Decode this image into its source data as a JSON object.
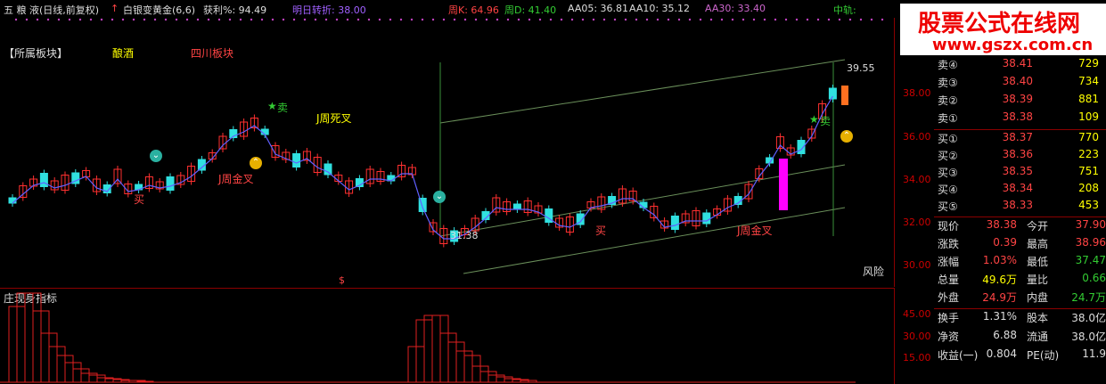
{
  "toolbar": {
    "stock_name": "五 粮 液(日线,前复权)",
    "arrow": "↑",
    "indicator_name": "白银变黄金(6,6)",
    "profit_label": "获利%: 94.49",
    "turn_label": "明日转折: 38.00",
    "weekk_label": "周K: 64.96",
    "weekd_label": "周D: 41.40",
    "aa05_label": "AA05: 36.81",
    "aa10_label": "AA10: 35.12",
    "aa30_label": "AA30: 33.40",
    "cut_label": "中轨:"
  },
  "sector": {
    "label": "【所属板块】",
    "tag1": "酿酒",
    "tag2": "四川板块"
  },
  "annotations": {
    "sell_top": "卖",
    "j_dead": "J周死叉",
    "j_gold1": "J周金叉",
    "j_gold2": "J周金叉",
    "buy1": "买",
    "buy2": "买",
    "sell2": "卖",
    "low_price": "31.38",
    "high_price": "39.55",
    "risk": "风险",
    "dollar": "$"
  },
  "price_axis": [
    "38.00",
    "36.00",
    "34.00",
    "32.00",
    "30.00"
  ],
  "indicator": {
    "title": "庄现身指标",
    "axis": [
      "45.00",
      "30.00",
      "15.00"
    ]
  },
  "watermark": {
    "title": "股票公式在线网",
    "url": "www.gszx.com.cn"
  },
  "quote": {
    "asks": [
      {
        "label": "卖④",
        "price": "38.41",
        "vol": "729"
      },
      {
        "label": "卖③",
        "price": "38.40",
        "vol": "734"
      },
      {
        "label": "卖②",
        "price": "38.39",
        "vol": "881"
      },
      {
        "label": "卖①",
        "price": "38.38",
        "vol": "109"
      }
    ],
    "bids": [
      {
        "label": "买①",
        "price": "38.37",
        "vol": "770"
      },
      {
        "label": "买②",
        "price": "38.36",
        "vol": "223"
      },
      {
        "label": "买③",
        "price": "38.35",
        "vol": "751"
      },
      {
        "label": "买④",
        "price": "38.34",
        "vol": "208"
      },
      {
        "label": "买⑤",
        "price": "38.33",
        "vol": "453"
      }
    ],
    "stats": [
      {
        "l1": "现价",
        "v1": "38.38",
        "c1": "#f44",
        "l2": "今开",
        "v2": "37.90",
        "c2": "#f44"
      },
      {
        "l1": "涨跌",
        "v1": "0.39",
        "c1": "#f44",
        "l2": "最高",
        "v2": "38.96",
        "c2": "#f44"
      },
      {
        "l1": "涨幅",
        "v1": "1.03%",
        "c1": "#f44",
        "l2": "最低",
        "v2": "37.47",
        "c2": "#3c3"
      },
      {
        "l1": "总量",
        "v1": "49.6万",
        "c1": "#ff0",
        "l2": "量比",
        "v2": "0.66",
        "c2": "#3c3"
      },
      {
        "l1": "外盘",
        "v1": "24.9万",
        "c1": "#f44",
        "l2": "内盘",
        "v2": "24.7万",
        "c2": "#3c3"
      }
    ],
    "fund": [
      {
        "l1": "换手",
        "v1": "1.31%",
        "l2": "股本",
        "v2": "38.0亿"
      },
      {
        "l1": "净资",
        "v1": "6.88",
        "l2": "流通",
        "v2": "38.0亿"
      },
      {
        "l1": "收益(一)",
        "v1": "0.804",
        "l2": "PE(动)",
        "v2": "11.9"
      }
    ]
  }
}
